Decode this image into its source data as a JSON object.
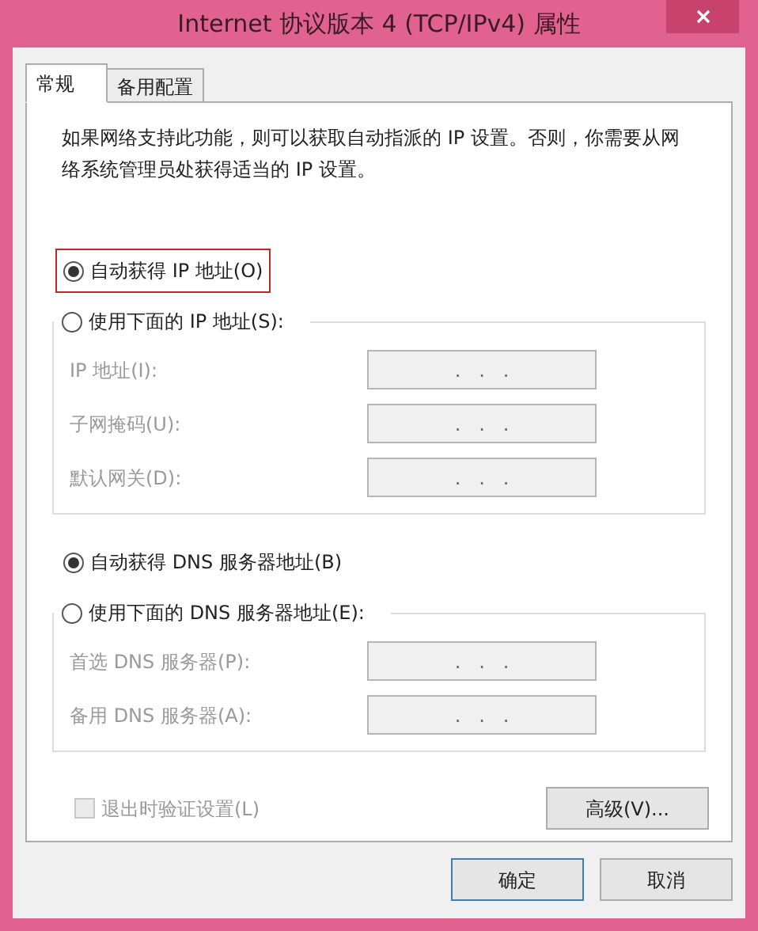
{
  "window": {
    "title": "Internet 协议版本 4 (TCP/IPv4) 属性"
  },
  "tabs": [
    {
      "label": "常规",
      "selected": true
    },
    {
      "label": "备用配置",
      "selected": false
    }
  ],
  "description": "如果网络支持此功能，则可以获取自动指派的 IP 设置。否则，你需要从网络系统管理员处获得适当的 IP 设置。",
  "ip_options": [
    {
      "label": "自动获得 IP 地址(O)",
      "selected": true,
      "highlighted": true
    },
    {
      "label": "使用下面的 IP 地址(S):",
      "selected": false,
      "highlighted": false
    }
  ],
  "ip_fields": {
    "disabled": true,
    "items": [
      {
        "label": "IP 地址(I):",
        "value": ".   .   ."
      },
      {
        "label": "子网掩码(U):",
        "value": ".   .   ."
      },
      {
        "label": "默认网关(D):",
        "value": ".   .   ."
      }
    ]
  },
  "dns_options": [
    {
      "label": "自动获得 DNS 服务器地址(B)",
      "selected": true,
      "highlighted": false
    },
    {
      "label": "使用下面的 DNS 服务器地址(E):",
      "selected": false,
      "highlighted": false
    }
  ],
  "dns_fields": {
    "disabled": true,
    "items": [
      {
        "label": "首选 DNS 服务器(P):",
        "value": ".   .   ."
      },
      {
        "label": "备用 DNS 服务器(A):",
        "value": ".   .   ."
      }
    ]
  },
  "validate_checkbox": {
    "label": "退出时验证设置(L)",
    "checked": false,
    "disabled": true
  },
  "advanced_button": "高级(V)...",
  "buttons": [
    {
      "label": "确定",
      "default": true
    },
    {
      "label": "取消",
      "default": false
    }
  ]
}
